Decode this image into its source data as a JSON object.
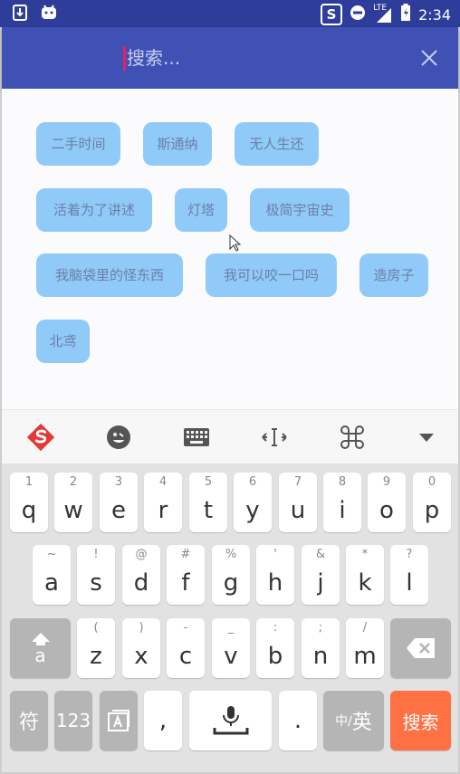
{
  "statusbar": {
    "time": "2:34",
    "network": "LTE",
    "app_badge": "S"
  },
  "search": {
    "placeholder": "搜索..."
  },
  "tags": [
    "二手时间",
    "斯通纳",
    "无人生还",
    "活着为了讲述",
    "灯塔",
    "极简宇宙史",
    "我脑袋里的怪东西",
    "我可以咬一口吗",
    "造房子",
    "北鸢"
  ],
  "keyboard": {
    "row1": [
      {
        "hint": "1",
        "label": "q"
      },
      {
        "hint": "2",
        "label": "w"
      },
      {
        "hint": "3",
        "label": "e"
      },
      {
        "hint": "4",
        "label": "r"
      },
      {
        "hint": "5",
        "label": "t"
      },
      {
        "hint": "6",
        "label": "y"
      },
      {
        "hint": "7",
        "label": "u"
      },
      {
        "hint": "8",
        "label": "i"
      },
      {
        "hint": "9",
        "label": "o"
      },
      {
        "hint": "0",
        "label": "p"
      }
    ],
    "row2": [
      {
        "hint": "~",
        "label": "a"
      },
      {
        "hint": "!",
        "label": "s"
      },
      {
        "hint": "@",
        "label": "d"
      },
      {
        "hint": "#",
        "label": "f"
      },
      {
        "hint": "%",
        "label": "g"
      },
      {
        "hint": "'",
        "label": "h"
      },
      {
        "hint": "&",
        "label": "j"
      },
      {
        "hint": "*",
        "label": "k"
      },
      {
        "hint": "?",
        "label": "l"
      }
    ],
    "row3": [
      {
        "hint": "(",
        "label": "z"
      },
      {
        "hint": ")",
        "label": "x"
      },
      {
        "hint": "-",
        "label": "c"
      },
      {
        "hint": "_",
        "label": "v"
      },
      {
        "hint": ":",
        "label": "b"
      },
      {
        "hint": ";",
        "label": "n"
      },
      {
        "hint": "/",
        "label": "m"
      }
    ],
    "shift_sub": "a",
    "symbols_label": "符",
    "numbers_label": "123",
    "comma_label": ",",
    "period_label": ".",
    "lang_small": "中/",
    "lang_large": "英",
    "search_label": "搜索"
  },
  "colors": {
    "statusbar": "#2e3d9a",
    "toolbar": "#3f51b5",
    "tag_bg": "#90caf9",
    "search_key": "#ff7043"
  }
}
